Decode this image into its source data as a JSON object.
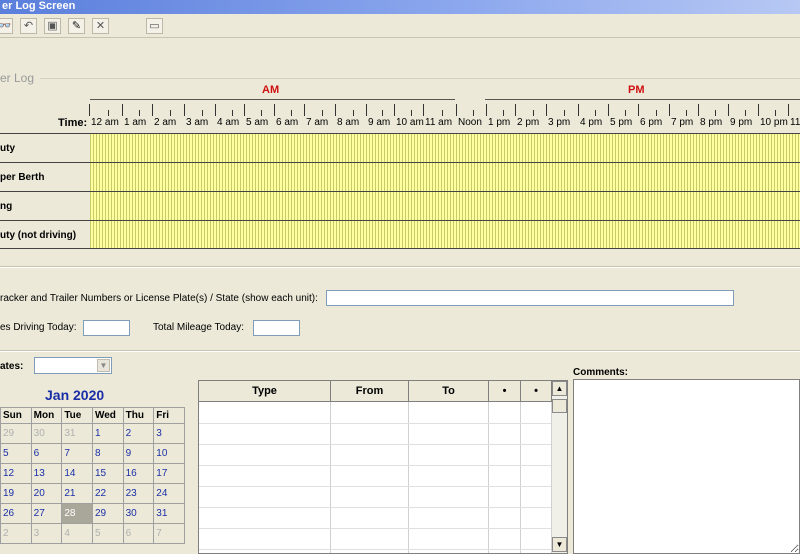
{
  "window": {
    "title": "er Log Screen"
  },
  "toolbar": {
    "buttons": [
      {
        "name": "binoculars-icon",
        "glyph": "👓"
      },
      {
        "name": "undo-icon",
        "glyph": "↶"
      },
      {
        "name": "save-icon",
        "glyph": "▣"
      },
      {
        "name": "edit-icon",
        "glyph": "✎"
      },
      {
        "name": "delete-icon",
        "glyph": "✕"
      },
      {
        "name": "blank-icon",
        "glyph": "▭"
      }
    ]
  },
  "log": {
    "group_title": "er Log",
    "am_label": "AM",
    "pm_label": "PM",
    "time_label": "Time:",
    "hours": [
      "12 am",
      "1 am",
      "2 am",
      "3 am",
      "4 am",
      "5 am",
      "6 am",
      "7 am",
      "8 am",
      "9 am",
      "10 am",
      "11 am",
      "Noon",
      "1 pm",
      "2 pm",
      "3 pm",
      "4 pm",
      "5 pm",
      "6 pm",
      "7 pm",
      "8 pm",
      "9 pm",
      "10 pm",
      "11"
    ],
    "statuses": [
      "uty",
      "per Berth",
      "ng",
      "uty (not driving)"
    ]
  },
  "form": {
    "tractor_label": "racker and Trailer Numbers or License Plate(s) / State (show each unit):",
    "tractor_value": "",
    "miles_label": "es Driving Today:",
    "miles_value": "",
    "total_mileage_label": "Total Mileage Today:",
    "total_mileage_value": "",
    "dates_label": "ates:",
    "dates_value": ""
  },
  "calendar": {
    "month_title": "Jan 2020",
    "days": [
      "Sun",
      "Mon",
      "Tue",
      "Wed",
      "Thu",
      "Fri"
    ],
    "weeks": [
      [
        {
          "d": "29",
          "dim": true
        },
        {
          "d": "30",
          "dim": true
        },
        {
          "d": "31",
          "dim": true
        },
        {
          "d": "1"
        },
        {
          "d": "2"
        },
        {
          "d": "3"
        }
      ],
      [
        {
          "d": "5"
        },
        {
          "d": "6"
        },
        {
          "d": "7"
        },
        {
          "d": "8"
        },
        {
          "d": "9"
        },
        {
          "d": "10"
        }
      ],
      [
        {
          "d": "12"
        },
        {
          "d": "13"
        },
        {
          "d": "14"
        },
        {
          "d": "15"
        },
        {
          "d": "16"
        },
        {
          "d": "17"
        }
      ],
      [
        {
          "d": "19"
        },
        {
          "d": "20"
        },
        {
          "d": "21"
        },
        {
          "d": "22"
        },
        {
          "d": "23"
        },
        {
          "d": "24"
        }
      ],
      [
        {
          "d": "26"
        },
        {
          "d": "27"
        },
        {
          "d": "28",
          "sel": true
        },
        {
          "d": "29"
        },
        {
          "d": "30"
        },
        {
          "d": "31"
        }
      ],
      [
        {
          "d": "2",
          "dim": true
        },
        {
          "d": "3",
          "dim": true
        },
        {
          "d": "4",
          "dim": true
        },
        {
          "d": "5",
          "dim": true
        },
        {
          "d": "6",
          "dim": true
        },
        {
          "d": "7",
          "dim": true
        }
      ]
    ]
  },
  "events": {
    "columns": [
      "Type",
      "From",
      "To",
      "•",
      "•"
    ],
    "rows": []
  },
  "comments": {
    "label": "Comments:",
    "value": ""
  }
}
